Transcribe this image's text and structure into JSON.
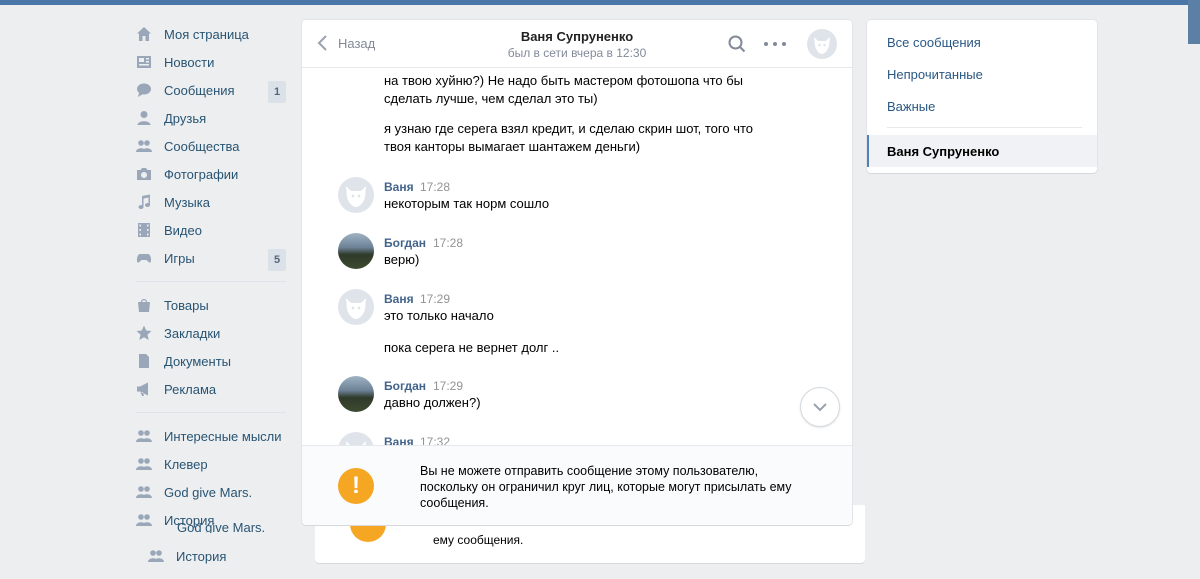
{
  "nav": {
    "items": [
      {
        "label": "Моя страница",
        "icon": "home-icon"
      },
      {
        "label": "Новости",
        "icon": "news-icon"
      },
      {
        "label": "Сообщения",
        "icon": "messages-icon",
        "badge": "1"
      },
      {
        "label": "Друзья",
        "icon": "friends-icon"
      },
      {
        "label": "Сообщества",
        "icon": "communities-icon"
      },
      {
        "label": "Фотографии",
        "icon": "camera-icon"
      },
      {
        "label": "Музыка",
        "icon": "music-icon"
      },
      {
        "label": "Видео",
        "icon": "video-icon"
      },
      {
        "label": "Игры",
        "icon": "games-icon",
        "badge": "5"
      }
    ],
    "items2": [
      {
        "label": "Товары",
        "icon": "bag-icon"
      },
      {
        "label": "Закладки",
        "icon": "star-icon"
      },
      {
        "label": "Документы",
        "icon": "document-icon"
      },
      {
        "label": "Реклама",
        "icon": "megaphone-icon"
      }
    ],
    "groups": [
      {
        "label": "Интересные мысли",
        "icon": "group-icon"
      },
      {
        "label": "Клевер",
        "icon": "group-icon"
      },
      {
        "label": "God give Mars.",
        "icon": "group-icon"
      },
      {
        "label": "История",
        "icon": "group-icon"
      }
    ]
  },
  "ghost": {
    "cut_label": "God give Mars.",
    "nav_label": "История",
    "notice_tail": "ему сообщения."
  },
  "chat": {
    "back_label": "Назад",
    "name": "Ваня Супруненко",
    "status": "был в сети вчера в 12:30",
    "messages": {
      "m0a": "на твою хуйню?) Не надо быть мастером фотошопа что бы",
      "m0b": "сделать лучше, чем сделал это ты)",
      "m1a": "я узнаю где серега взял кредит, и сделаю скрин шот, того что",
      "m1b": "твоя канторы вымагает шантажем деньги)",
      "g1_author": "Ваня",
      "g1_time": "17:28",
      "g1_text": "некоторым так норм сошло",
      "g2_author": "Богдан",
      "g2_time": "17:28",
      "g2_text": "верю)",
      "g3_author": "Ваня",
      "g3_time": "17:29",
      "g3_text": "это только начало",
      "g3_text2": "пока серега не вернет долг ..",
      "g4_author": "Богдан",
      "g4_time": "17:29",
      "g4_text": "давно должен?)",
      "g5_author": "Ваня",
      "g5_time": "17:32"
    },
    "notice": {
      "icon_glyph": "!",
      "text": "Вы не можете отправить сообщение этому пользователю, поскольку он ограничил круг лиц, которые могут присылать ему сообщения."
    }
  },
  "filters": {
    "all": "Все сообщения",
    "unread": "Непрочитанные",
    "important": "Важные",
    "active_dialog": "Ваня Супруненко"
  },
  "colors": {
    "brand": "#4a76a8",
    "link": "#285473",
    "warning": "#f5a623",
    "background": "#edeef0"
  }
}
